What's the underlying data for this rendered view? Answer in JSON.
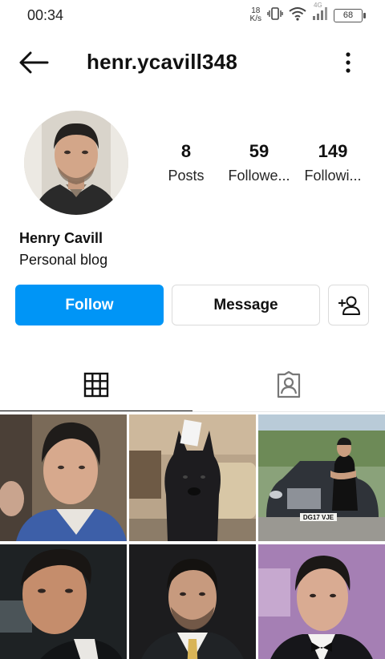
{
  "status_bar": {
    "time": "00:34",
    "net_speed_value": "18",
    "net_speed_unit": "K/s",
    "signal_label": "4G",
    "battery": "68"
  },
  "header": {
    "username": "henr.ycavill348"
  },
  "profile": {
    "stats": [
      {
        "value": "8",
        "label": "Posts"
      },
      {
        "value": "59",
        "label": "Followe..."
      },
      {
        "value": "149",
        "label": "Followi..."
      }
    ],
    "name": "Henry Cavill",
    "bio": "Personal blog"
  },
  "actions": {
    "follow": "Follow",
    "message": "Message"
  },
  "tabs": [
    {
      "id": "grid",
      "icon": "grid-icon",
      "active": true
    },
    {
      "id": "tagged",
      "icon": "tagged-person-icon",
      "active": false
    }
  ],
  "car_plate": "DG17 VJE",
  "colors": {
    "accent": "#0095f6",
    "border": "#dbdbdb"
  }
}
